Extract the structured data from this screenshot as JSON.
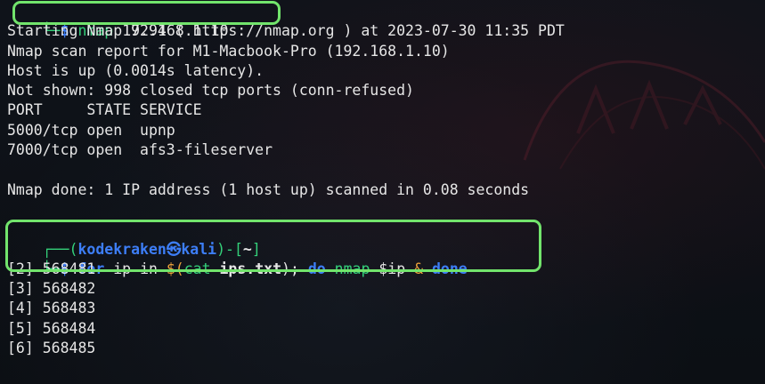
{
  "terminal": {
    "cmd1": {
      "prompt_corner": "└─",
      "prompt_symbol": "$",
      "command": "nmap",
      "arg": "192.168.1.10"
    },
    "output": [
      "Starting Nmap 7.94 ( https://nmap.org ) at 2023-07-30 11:35 PDT",
      "Nmap scan report for M1-Macbook-Pro (192.168.1.10)",
      "Host is up (0.0014s latency).",
      "Not shown: 998 closed tcp ports (conn-refused)",
      "PORT     STATE SERVICE",
      "5000/tcp open  upnp",
      "7000/tcp open  afs3-fileserver",
      "",
      "Nmap done: 1 IP address (1 host up) scanned in 0.08 seconds",
      ""
    ],
    "prompt2": {
      "corner_top": "┌──(",
      "user": "kodekraken",
      "at": "㉿",
      "host": "kali",
      "mid": ")-[",
      "dir": "~",
      "end": "]",
      "corner_bottom": "└─",
      "symbol": "$"
    },
    "cmd2": {
      "kw_for": "for",
      "var": "ip",
      "kw_in": "in",
      "sub_open": "$(",
      "sub_cmd": "cat",
      "sub_arg": "ips.txt",
      "sub_close": ");",
      "kw_do": "do",
      "cmd": "nmap",
      "cmd_arg": "$ip",
      "amp": "&",
      "kw_done": "done"
    },
    "jobs": [
      "[2] 568481",
      "[3] 568482",
      "[4] 568483",
      "[5] 568484",
      "[6] 568485"
    ]
  },
  "colors": {
    "highlight_box": "#72e46c",
    "prompt_green": "#34d17a",
    "prompt_blue": "#3d7ef7"
  }
}
